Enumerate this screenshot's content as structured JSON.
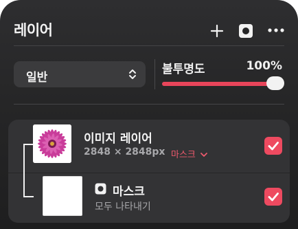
{
  "panel": {
    "title": "레이어",
    "accent_color": "#e8455a"
  },
  "header_actions": [
    {
      "icon": "plus-icon"
    },
    {
      "icon": "mask-icon"
    },
    {
      "icon": "more-icon"
    }
  ],
  "blend_mode": {
    "value": "일반",
    "icon": "chevron-up-down-icon"
  },
  "opacity": {
    "label": "불투명도",
    "value_text": "100%",
    "fraction": 1.0
  },
  "layers": [
    {
      "name": "이미지 레이어",
      "dimensions": "2848 × 2848px",
      "mask_label": "마스크",
      "visible": true,
      "thumbnail": "pink-flower"
    },
    {
      "name": "마스크",
      "icon": "mask-icon",
      "subtitle": "모두 나타내기",
      "visible": true,
      "thumbnail": "white"
    }
  ]
}
